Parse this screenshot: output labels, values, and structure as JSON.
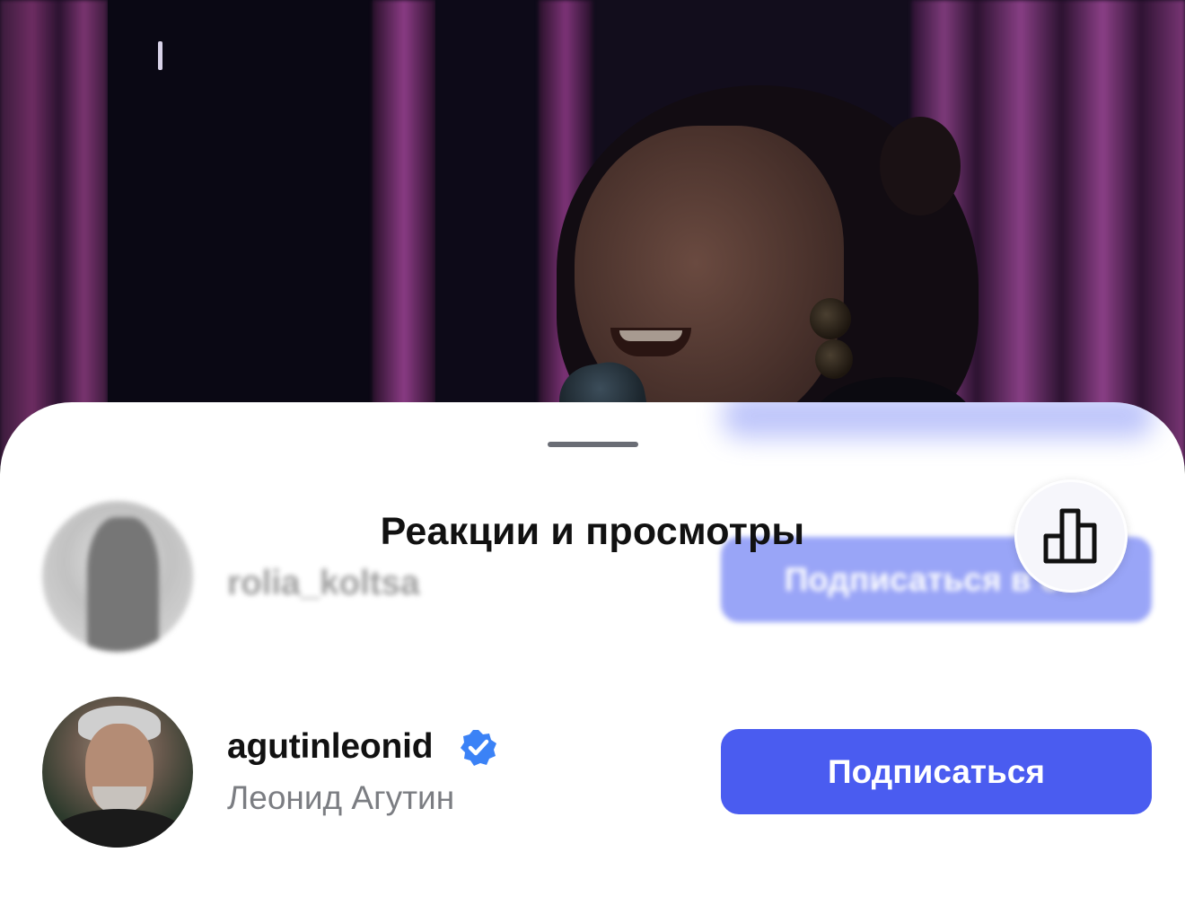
{
  "sheet": {
    "title": "Реакции и просмотры"
  },
  "viewers": [
    {
      "username": "rolia_koltsa",
      "button_label": "Подписаться в о..."
    },
    {
      "username": "agutinleonid",
      "full_name": "Леонид Агутин",
      "verified": true,
      "button_label": "Подписаться"
    }
  ],
  "icons": {
    "stats": "bar-chart-icon",
    "verified": "verified-badge-icon",
    "grabber": "sheet-grabber"
  },
  "colors": {
    "accent": "#4a5cf0",
    "verified": "#3b82f6",
    "secondary_text": "#7b7d82"
  }
}
